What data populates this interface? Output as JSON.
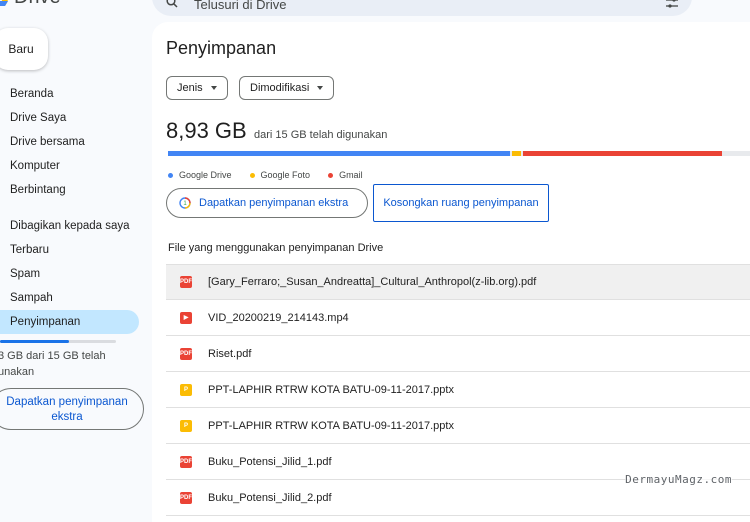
{
  "app": {
    "name": "Drive"
  },
  "search": {
    "value": "Telusuri di Drive"
  },
  "sidebar": {
    "new_label": "Baru",
    "items": [
      {
        "label": "Beranda"
      },
      {
        "label": "Drive Saya"
      },
      {
        "label": "Drive bersama"
      },
      {
        "label": "Komputer"
      },
      {
        "label": "Berbintang"
      },
      {
        "label": "Dibagikan kepada saya"
      },
      {
        "label": "Terbaru"
      },
      {
        "label": "Spam"
      },
      {
        "label": "Sampah"
      },
      {
        "label": "Penyimpanan",
        "active": true
      }
    ],
    "quota_text_line1": "3 GB dari 15 GB telah",
    "quota_text_line2": "unakan",
    "quota_fraction": 0.595,
    "cta_line1": "Dapatkan penyimpanan",
    "cta_line2": "ekstra"
  },
  "main": {
    "title": "Penyimpanan",
    "filters": [
      {
        "label": "Jenis"
      },
      {
        "label": "Dimodifikasi"
      }
    ],
    "used_value": "8,93 GB",
    "used_caption": "dari 15 GB telah digunakan",
    "breakdown": [
      {
        "label": "Google Drive",
        "color": "#4285f4",
        "fraction": 0.5665
      },
      {
        "label": "Google Foto",
        "color": "#fbbc04",
        "fraction": 0.015
      },
      {
        "label": "Gmail",
        "color": "#ea4335",
        "fraction": 0.33
      }
    ],
    "get_storage_button": "Dapatkan penyimpanan ekstra",
    "clean_button": "Kosongkan ruang penyimpanan",
    "files_heading": "File yang menggunakan penyimpanan Drive",
    "files": [
      {
        "name": "[Gary_Ferraro;_Susan_Andreatta]_Cultural_Anthropol(z-lib.org).pdf",
        "type": "pdf"
      },
      {
        "name": "VID_20200219_214143.mp4",
        "type": "video"
      },
      {
        "name": "Riset.pdf",
        "type": "pdf"
      },
      {
        "name": "PPT-LAPHIR RTRW KOTA BATU-09-11-2017.pptx",
        "type": "ppt"
      },
      {
        "name": "PPT-LAPHIR RTRW KOTA BATU-09-11-2017.pptx",
        "type": "ppt"
      },
      {
        "name": "Buku_Potensi_Jilid_1.pdf",
        "type": "pdf"
      },
      {
        "name": "Buku_Potensi_Jilid_2.pdf",
        "type": "pdf"
      }
    ]
  },
  "watermark": "DermayuMagz.com",
  "colors": {
    "accent": "#0b57d0",
    "active_nav": "#c2e7ff",
    "panel_bg": "#f8fafd"
  }
}
